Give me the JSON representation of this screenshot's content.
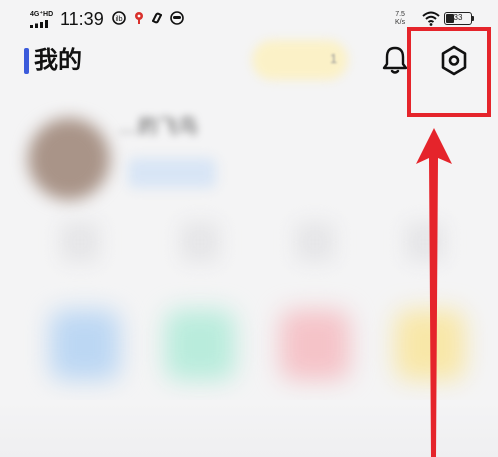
{
  "status_bar": {
    "network": "4G⁺HD",
    "time": "11:39",
    "speed_value": "7.5",
    "speed_unit": "K/s",
    "battery_level": "33",
    "icons": [
      "weibo-icon",
      "map-pin-icon",
      "link-icon",
      "face-icon",
      "wifi-icon",
      "battery-icon"
    ]
  },
  "header": {
    "title": "我的",
    "vip_pill_text": "1",
    "notification_icon": "bell-icon",
    "settings_icon": "hexagon-settings-icon",
    "accent_color": "#3b5bdb"
  },
  "profile": {
    "nickname": "…的飞鸟"
  },
  "annotation": {
    "color": "#e5242b",
    "target": "settings-button"
  }
}
